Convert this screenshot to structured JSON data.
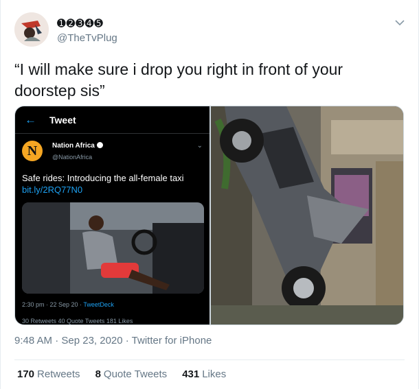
{
  "author": {
    "display_name": "➊➋➌➍➎",
    "handle": "@TheTvPlug"
  },
  "tweet": {
    "text": "“I will make sure i drop you right in front of your doorstep sis”"
  },
  "embedded_screenshot": {
    "back_icon": "arrow-left-icon",
    "header_title": "Tweet",
    "logo_letter": "N",
    "account_name": "Nation Africa",
    "account_handle": "@NationAfrica",
    "text": "Safe rides: Introducing the all-female taxi",
    "link": "bit.ly/2RQ77N0",
    "meta_time": "2:30 pm · 22 Sep 20 · ",
    "meta_app": "TweetDeck",
    "stats": "30 Retweets   40 Quote Tweets   181 Likes"
  },
  "footer": {
    "timestamp": "9:48 AM · Sep 23, 2020 · Twitter for iPhone"
  },
  "stats": {
    "retweets_count": "170",
    "retweets_label": "Retweets",
    "quotes_count": "8",
    "quotes_label": "Quote Tweets",
    "likes_count": "431",
    "likes_label": "Likes"
  },
  "colors": {
    "accent": "#1da1f2",
    "text": "#14171a",
    "muted": "#657786"
  }
}
